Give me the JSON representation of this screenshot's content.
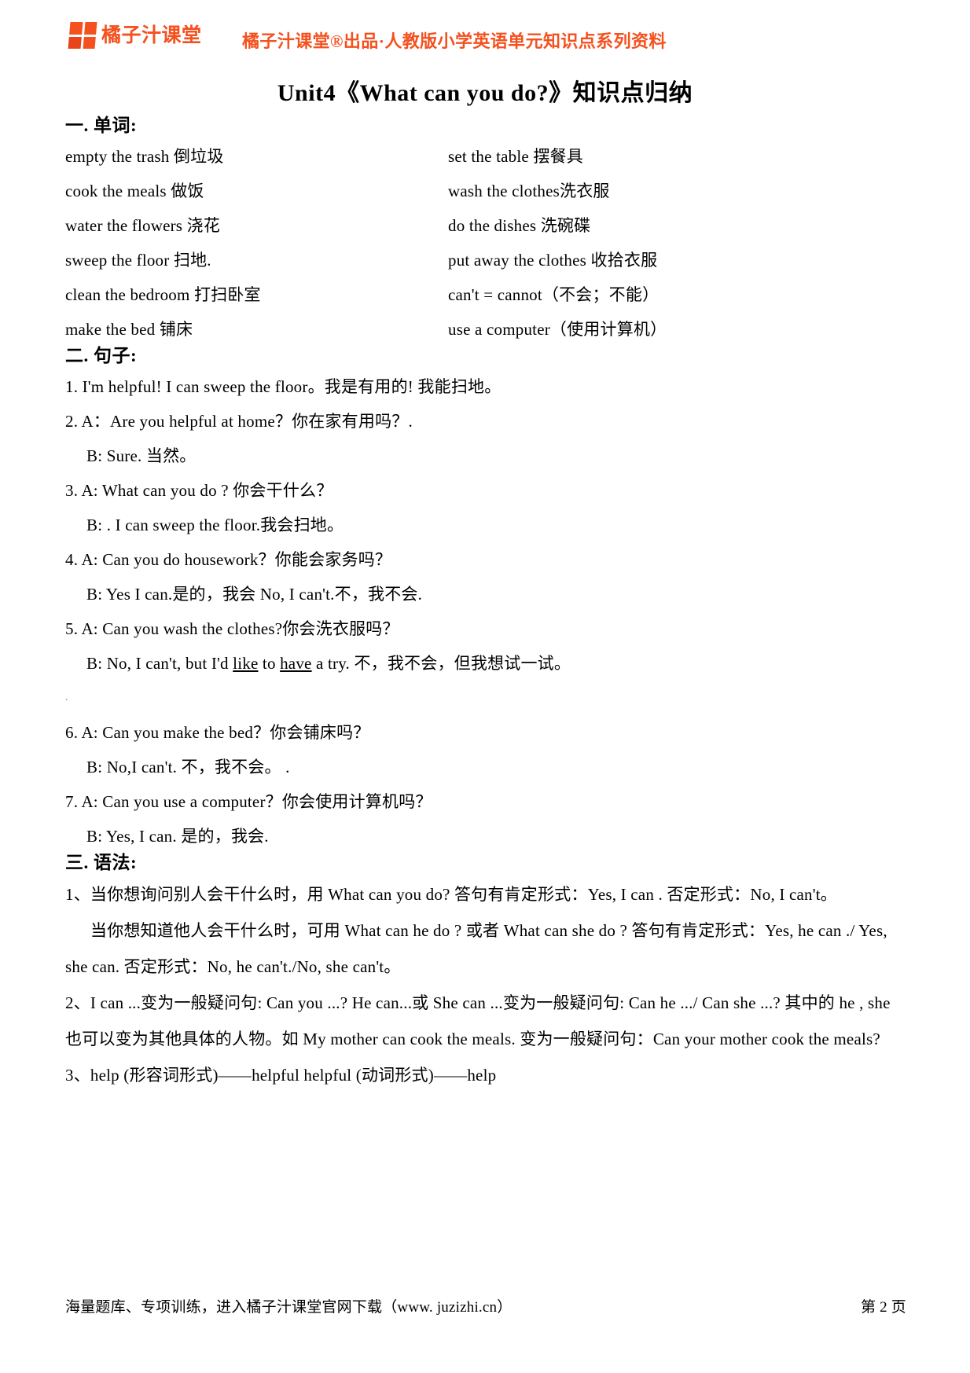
{
  "header": {
    "logo_text": "橘子汁课堂",
    "logo_icon": "four-square-grid-logo",
    "tagline": "橘子汁课堂®出品·人教版小学英语单元知识点系列资料",
    "brand_color": "#f4511e"
  },
  "title": "Unit4《What can you do?》知识点归纳",
  "sections": {
    "vocabulary": {
      "heading": "一. 单词:",
      "items_left": [
        "empty the trash 倒垃圾",
        "cook the meals  做饭",
        "water  the flowers 浇花",
        "sweep the floor 扫地.",
        "clean the bedroom 打扫卧室",
        "make the bed 铺床"
      ],
      "items_right": [
        "set the table 摆餐具",
        "wash the clothes洗衣服",
        "do the dishes 洗碗碟",
        "put away the clothes 收拾衣服",
        "can't = cannot（不会；不能）",
        "use a computer（使用计算机）"
      ]
    },
    "sentences": {
      "heading": "二. 句子:",
      "lines": [
        {
          "text": "1. I'm helpful!     I can sweep the floor。我是有用的!   我能扫地。",
          "indent": false
        },
        {
          "text": "2. A：Are you helpful at home？你在家有用吗？.",
          "indent": false
        },
        {
          "text": "B:   Sure.    当然。",
          "indent": true
        },
        {
          "text": "3.  A:   What can you do ?   你会干什么？",
          "indent": false
        },
        {
          "text": "B: . I can sweep the floor.我会扫地。",
          "indent": true
        },
        {
          "text": "4. A: Can you do housework？你能会家务吗？",
          "indent": false
        },
        {
          "text": "B: Yes I can.是的，我会   No, I can't.不，我不会.",
          "indent": true
        },
        {
          "text": "5. A: Can you wash the clothes?你会洗衣服吗？",
          "indent": false
        },
        {
          "text": "B: No, I can't, but I'd like to have a try. 不，我不会，但我想试一试。",
          "indent": true,
          "underline": [
            "like",
            "have"
          ]
        },
        {
          "text": ".",
          "indent": false,
          "faint": true
        },
        {
          "text": "6.  A: Can you make the bed？你会铺床吗？",
          "indent": false
        },
        {
          "text": "B: No,I can't. 不，我不会。      .",
          "indent": true
        },
        {
          "text": "7. A: Can you use a computer？你会使用计算机吗？",
          "indent": false
        },
        {
          "text": "B: Yes, I can.    是的，我会.",
          "indent": true
        }
      ]
    },
    "grammar": {
      "heading": "三. 语法:",
      "paragraphs": [
        {
          "text": "1、当你想询问别人会干什么时，用 What can you do? 答句有肯定形式：Yes, I can . 否定形式：No, I can't。",
          "indent": false
        },
        {
          "text": "当你想知道他人会干什么时，可用 What can he do ? 或者 What can she do ? 答句有肯定形式：Yes, he can ./ Yes, she can. 否定形式：No, he can't./No, she can't。",
          "indent": true
        },
        {
          "text": "2、I can ...变为一般疑问句: Can you ...?        He can...或 She can ...变为一般疑问句: Can he .../ Can   she ...? 其中的 he , she  也可以变为其他具体的人物。如  My mother can cook the meals. 变为一般疑问句：Can your mother cook the meals?",
          "indent": false
        },
        {
          "text": "3、help (形容词形式)——helpful        helpful (动词形式)——help",
          "indent": false
        }
      ]
    }
  },
  "footer": {
    "left": "海量题库、专项训练，进入橘子汁课堂官网下载（www. juzizhi.cn）",
    "right": "第 2 页"
  }
}
